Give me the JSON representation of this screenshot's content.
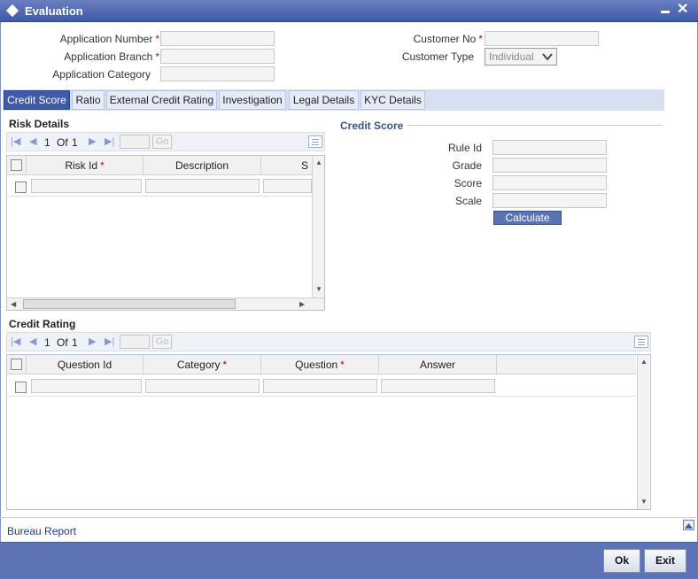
{
  "window": {
    "title": "Evaluation",
    "minimize_icon": "minimize-icon",
    "close_glyph": "✕"
  },
  "header": {
    "application_number_label": "Application Number",
    "application_branch_label": "Application Branch",
    "application_category_label": "Application Category",
    "customer_no_label": "Customer No",
    "customer_type_label": "Customer Type",
    "customer_type_value": "Individual",
    "required_mark": "*"
  },
  "tabs": [
    "Credit Score",
    "Ratio",
    "External Credit Rating",
    "Investigation",
    "Legal Details",
    "KYC Details"
  ],
  "active_tab": "Credit Score",
  "risk_details": {
    "title": "Risk Details",
    "pager": {
      "current": "1",
      "of_label": "Of",
      "total": "1",
      "go_label": "Go"
    },
    "columns": [
      "Risk Id",
      "Description",
      "S"
    ],
    "risk_id_required": "*"
  },
  "credit_score": {
    "title": "Credit Score",
    "rule_id_label": "Rule Id",
    "grade_label": "Grade",
    "score_label": "Score",
    "scale_label": "Scale",
    "calculate_label": "Calculate"
  },
  "credit_rating": {
    "title": "Credit Rating",
    "pager": {
      "current": "1",
      "of_label": "Of",
      "total": "1",
      "go_label": "Go"
    },
    "columns": [
      "Question Id",
      "Category",
      "Question",
      "Answer"
    ],
    "required_mark": "*"
  },
  "footer": {
    "bureau_report_label": "Bureau Report",
    "ok_label": "Ok",
    "exit_label": "Exit"
  },
  "colors": {
    "titlebar": "#3e5aa8",
    "bottombar": "#5e73b6",
    "active_tab": "#3e5aa8",
    "required": "#cc0000"
  }
}
